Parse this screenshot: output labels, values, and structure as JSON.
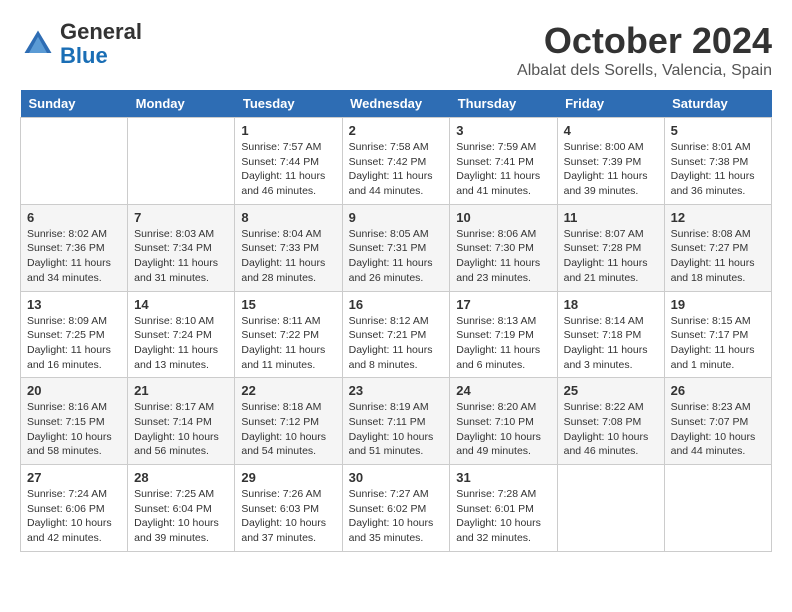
{
  "header": {
    "logo_general": "General",
    "logo_blue": "Blue",
    "month": "October 2024",
    "location": "Albalat dels Sorells, Valencia, Spain"
  },
  "days_of_week": [
    "Sunday",
    "Monday",
    "Tuesday",
    "Wednesday",
    "Thursday",
    "Friday",
    "Saturday"
  ],
  "weeks": [
    [
      {
        "day": "",
        "info": ""
      },
      {
        "day": "",
        "info": ""
      },
      {
        "day": "1",
        "info": "Sunrise: 7:57 AM\nSunset: 7:44 PM\nDaylight: 11 hours and 46 minutes."
      },
      {
        "day": "2",
        "info": "Sunrise: 7:58 AM\nSunset: 7:42 PM\nDaylight: 11 hours and 44 minutes."
      },
      {
        "day": "3",
        "info": "Sunrise: 7:59 AM\nSunset: 7:41 PM\nDaylight: 11 hours and 41 minutes."
      },
      {
        "day": "4",
        "info": "Sunrise: 8:00 AM\nSunset: 7:39 PM\nDaylight: 11 hours and 39 minutes."
      },
      {
        "day": "5",
        "info": "Sunrise: 8:01 AM\nSunset: 7:38 PM\nDaylight: 11 hours and 36 minutes."
      }
    ],
    [
      {
        "day": "6",
        "info": "Sunrise: 8:02 AM\nSunset: 7:36 PM\nDaylight: 11 hours and 34 minutes."
      },
      {
        "day": "7",
        "info": "Sunrise: 8:03 AM\nSunset: 7:34 PM\nDaylight: 11 hours and 31 minutes."
      },
      {
        "day": "8",
        "info": "Sunrise: 8:04 AM\nSunset: 7:33 PM\nDaylight: 11 hours and 28 minutes."
      },
      {
        "day": "9",
        "info": "Sunrise: 8:05 AM\nSunset: 7:31 PM\nDaylight: 11 hours and 26 minutes."
      },
      {
        "day": "10",
        "info": "Sunrise: 8:06 AM\nSunset: 7:30 PM\nDaylight: 11 hours and 23 minutes."
      },
      {
        "day": "11",
        "info": "Sunrise: 8:07 AM\nSunset: 7:28 PM\nDaylight: 11 hours and 21 minutes."
      },
      {
        "day": "12",
        "info": "Sunrise: 8:08 AM\nSunset: 7:27 PM\nDaylight: 11 hours and 18 minutes."
      }
    ],
    [
      {
        "day": "13",
        "info": "Sunrise: 8:09 AM\nSunset: 7:25 PM\nDaylight: 11 hours and 16 minutes."
      },
      {
        "day": "14",
        "info": "Sunrise: 8:10 AM\nSunset: 7:24 PM\nDaylight: 11 hours and 13 minutes."
      },
      {
        "day": "15",
        "info": "Sunrise: 8:11 AM\nSunset: 7:22 PM\nDaylight: 11 hours and 11 minutes."
      },
      {
        "day": "16",
        "info": "Sunrise: 8:12 AM\nSunset: 7:21 PM\nDaylight: 11 hours and 8 minutes."
      },
      {
        "day": "17",
        "info": "Sunrise: 8:13 AM\nSunset: 7:19 PM\nDaylight: 11 hours and 6 minutes."
      },
      {
        "day": "18",
        "info": "Sunrise: 8:14 AM\nSunset: 7:18 PM\nDaylight: 11 hours and 3 minutes."
      },
      {
        "day": "19",
        "info": "Sunrise: 8:15 AM\nSunset: 7:17 PM\nDaylight: 11 hours and 1 minute."
      }
    ],
    [
      {
        "day": "20",
        "info": "Sunrise: 8:16 AM\nSunset: 7:15 PM\nDaylight: 10 hours and 58 minutes."
      },
      {
        "day": "21",
        "info": "Sunrise: 8:17 AM\nSunset: 7:14 PM\nDaylight: 10 hours and 56 minutes."
      },
      {
        "day": "22",
        "info": "Sunrise: 8:18 AM\nSunset: 7:12 PM\nDaylight: 10 hours and 54 minutes."
      },
      {
        "day": "23",
        "info": "Sunrise: 8:19 AM\nSunset: 7:11 PM\nDaylight: 10 hours and 51 minutes."
      },
      {
        "day": "24",
        "info": "Sunrise: 8:20 AM\nSunset: 7:10 PM\nDaylight: 10 hours and 49 minutes."
      },
      {
        "day": "25",
        "info": "Sunrise: 8:22 AM\nSunset: 7:08 PM\nDaylight: 10 hours and 46 minutes."
      },
      {
        "day": "26",
        "info": "Sunrise: 8:23 AM\nSunset: 7:07 PM\nDaylight: 10 hours and 44 minutes."
      }
    ],
    [
      {
        "day": "27",
        "info": "Sunrise: 7:24 AM\nSunset: 6:06 PM\nDaylight: 10 hours and 42 minutes."
      },
      {
        "day": "28",
        "info": "Sunrise: 7:25 AM\nSunset: 6:04 PM\nDaylight: 10 hours and 39 minutes."
      },
      {
        "day": "29",
        "info": "Sunrise: 7:26 AM\nSunset: 6:03 PM\nDaylight: 10 hours and 37 minutes."
      },
      {
        "day": "30",
        "info": "Sunrise: 7:27 AM\nSunset: 6:02 PM\nDaylight: 10 hours and 35 minutes."
      },
      {
        "day": "31",
        "info": "Sunrise: 7:28 AM\nSunset: 6:01 PM\nDaylight: 10 hours and 32 minutes."
      },
      {
        "day": "",
        "info": ""
      },
      {
        "day": "",
        "info": ""
      }
    ]
  ]
}
